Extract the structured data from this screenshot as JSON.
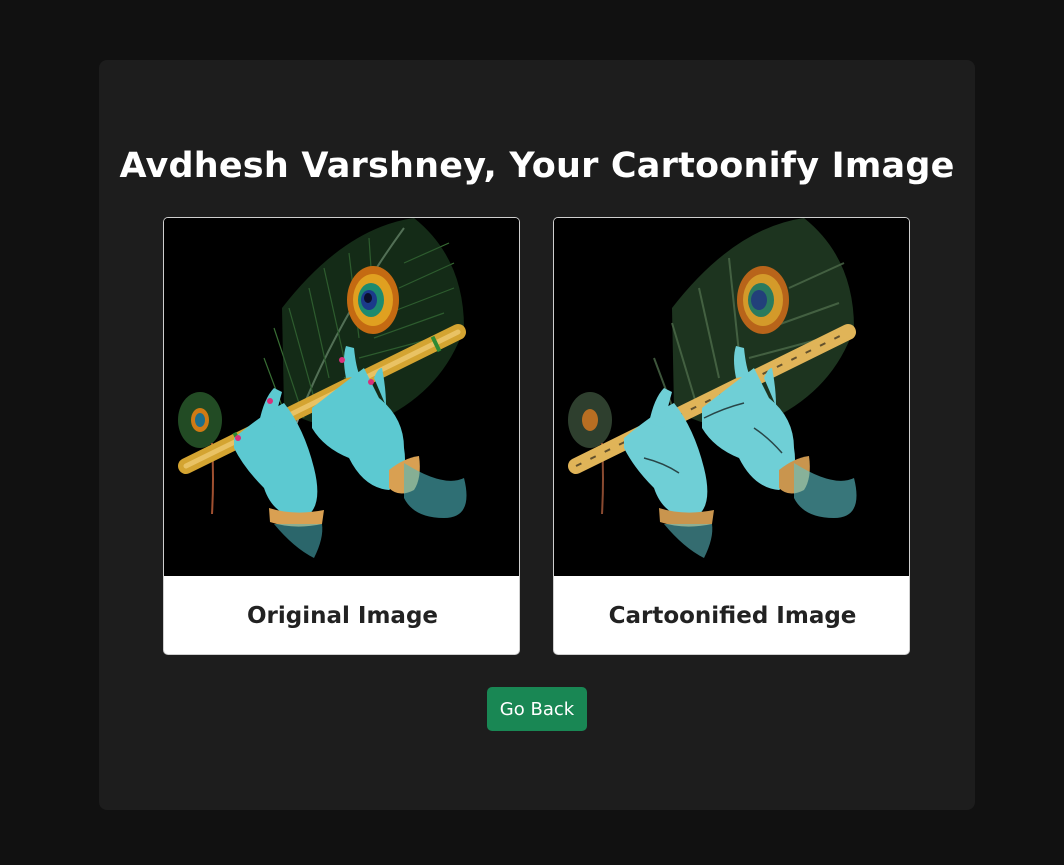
{
  "page": {
    "heading": "Avdhesh Varshney, Your Cartoonify Image"
  },
  "cards": [
    {
      "caption": "Original Image",
      "image": "krishna-flute-peacock-feather-original"
    },
    {
      "caption": "Cartoonified Image",
      "image": "krishna-flute-peacock-feather-cartoonified"
    }
  ],
  "actions": {
    "go_back_label": "Go Back"
  },
  "colors": {
    "page_background": "#111111",
    "panel_background": "#1d1d1d",
    "button_primary": "#198754",
    "heading_text": "#ffffff",
    "caption_text": "#222222"
  }
}
